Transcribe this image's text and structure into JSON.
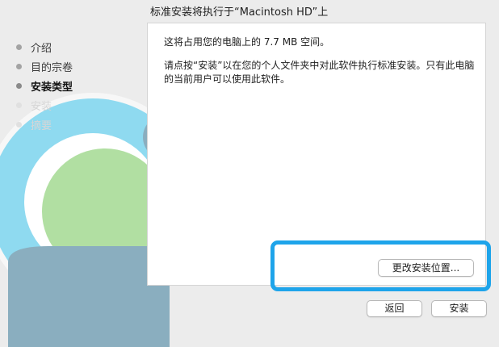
{
  "window": {
    "title": "标准安装将执行于“Macintosh HD”上"
  },
  "sidebar": {
    "steps": [
      {
        "label": "介绍",
        "state": "done"
      },
      {
        "label": "目的宗卷",
        "state": "done"
      },
      {
        "label": "安装类型",
        "state": "current"
      },
      {
        "label": "安装",
        "state": "future"
      },
      {
        "label": "摘要",
        "state": "future"
      }
    ]
  },
  "content": {
    "space_text": "这将占用您的电脑上的 7.7 MB 空间。",
    "instruction_text": "请点按“安装”以在您的个人文件夹中对此软件执行标准安装。只有此电脑的当前用户可以使用此软件。"
  },
  "buttons": {
    "change_location": "更改安装位置...",
    "back": "返回",
    "install": "安装"
  },
  "colors": {
    "highlight": "#1ea4ea"
  }
}
